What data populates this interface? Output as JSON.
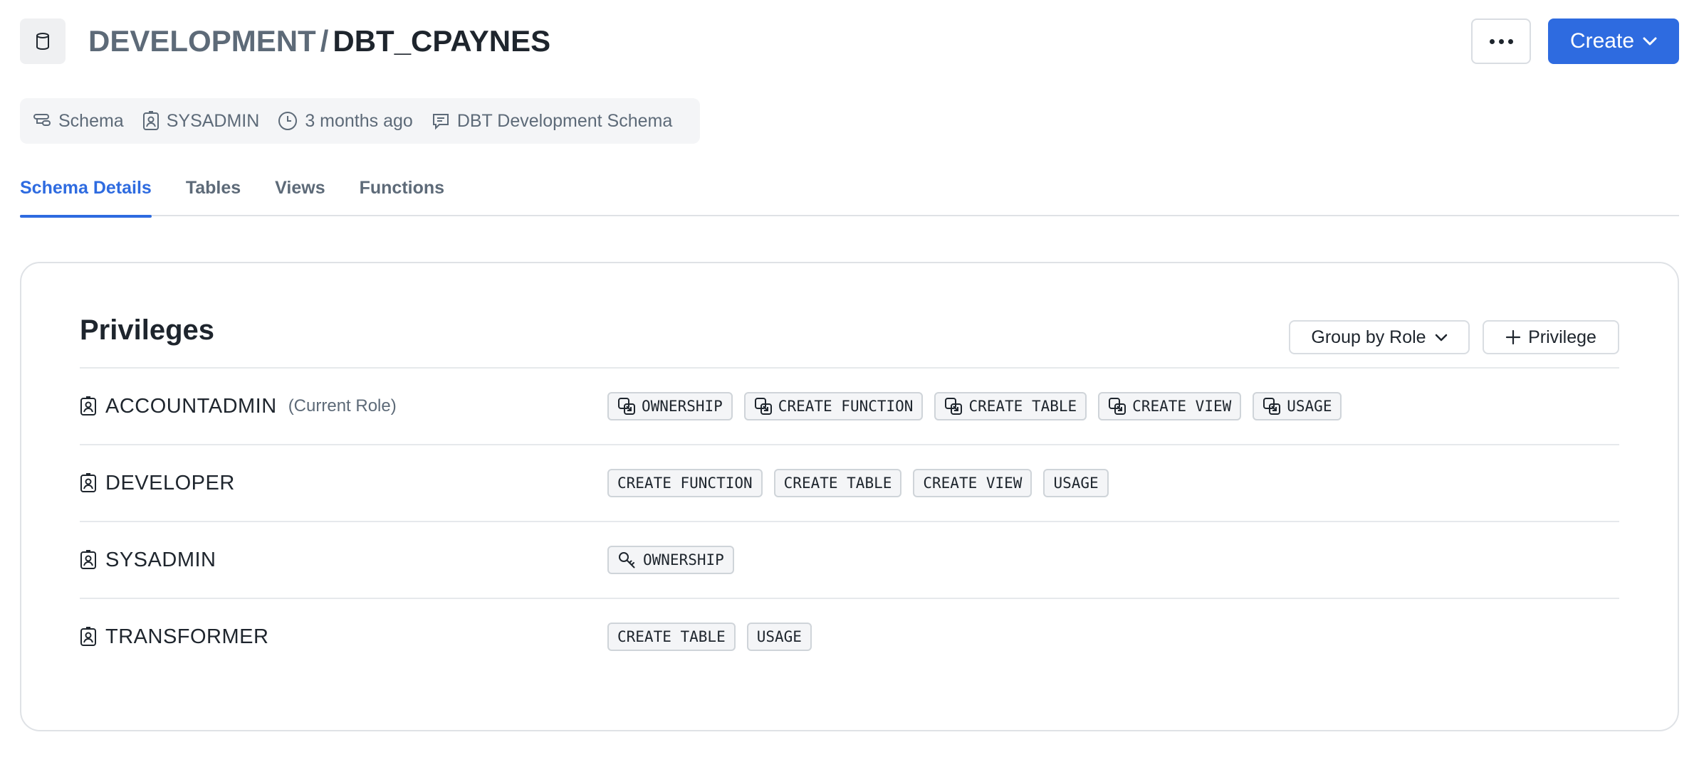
{
  "header": {
    "database": "DEVELOPMENT",
    "separator": "/",
    "schema": "DBT_CPAYNES",
    "more_icon": "ellipsis-icon",
    "create_label": "Create"
  },
  "meta": {
    "type": "Schema",
    "owner": "SYSADMIN",
    "created": "3 months ago",
    "comment": "DBT Development Schema"
  },
  "tabs": [
    {
      "label": "Schema Details",
      "active": true
    },
    {
      "label": "Tables",
      "active": false
    },
    {
      "label": "Views",
      "active": false
    },
    {
      "label": "Functions",
      "active": false
    }
  ],
  "privileges": {
    "title": "Privileges",
    "group_by_label": "Group by Role",
    "add_label": "Privilege",
    "rows": [
      {
        "role": "ACCOUNTADMIN",
        "note": "(Current Role)",
        "grants": [
          {
            "label": "OWNERSHIP",
            "icon": "inherited-icon"
          },
          {
            "label": "CREATE FUNCTION",
            "icon": "inherited-icon"
          },
          {
            "label": "CREATE TABLE",
            "icon": "inherited-icon"
          },
          {
            "label": "CREATE VIEW",
            "icon": "inherited-icon"
          },
          {
            "label": "USAGE",
            "icon": "inherited-icon"
          }
        ]
      },
      {
        "role": "DEVELOPER",
        "note": "",
        "grants": [
          {
            "label": "CREATE FUNCTION",
            "icon": ""
          },
          {
            "label": "CREATE TABLE",
            "icon": ""
          },
          {
            "label": "CREATE VIEW",
            "icon": ""
          },
          {
            "label": "USAGE",
            "icon": ""
          }
        ]
      },
      {
        "role": "SYSADMIN",
        "note": "",
        "grants": [
          {
            "label": "OWNERSHIP",
            "icon": "key-icon"
          }
        ]
      },
      {
        "role": "TRANSFORMER",
        "note": "",
        "grants": [
          {
            "label": "CREATE TABLE",
            "icon": ""
          },
          {
            "label": "USAGE",
            "icon": ""
          }
        ]
      }
    ]
  },
  "colors": {
    "accent": "#2e6be0",
    "text": "#1e252d",
    "muted": "#5d6a78"
  }
}
